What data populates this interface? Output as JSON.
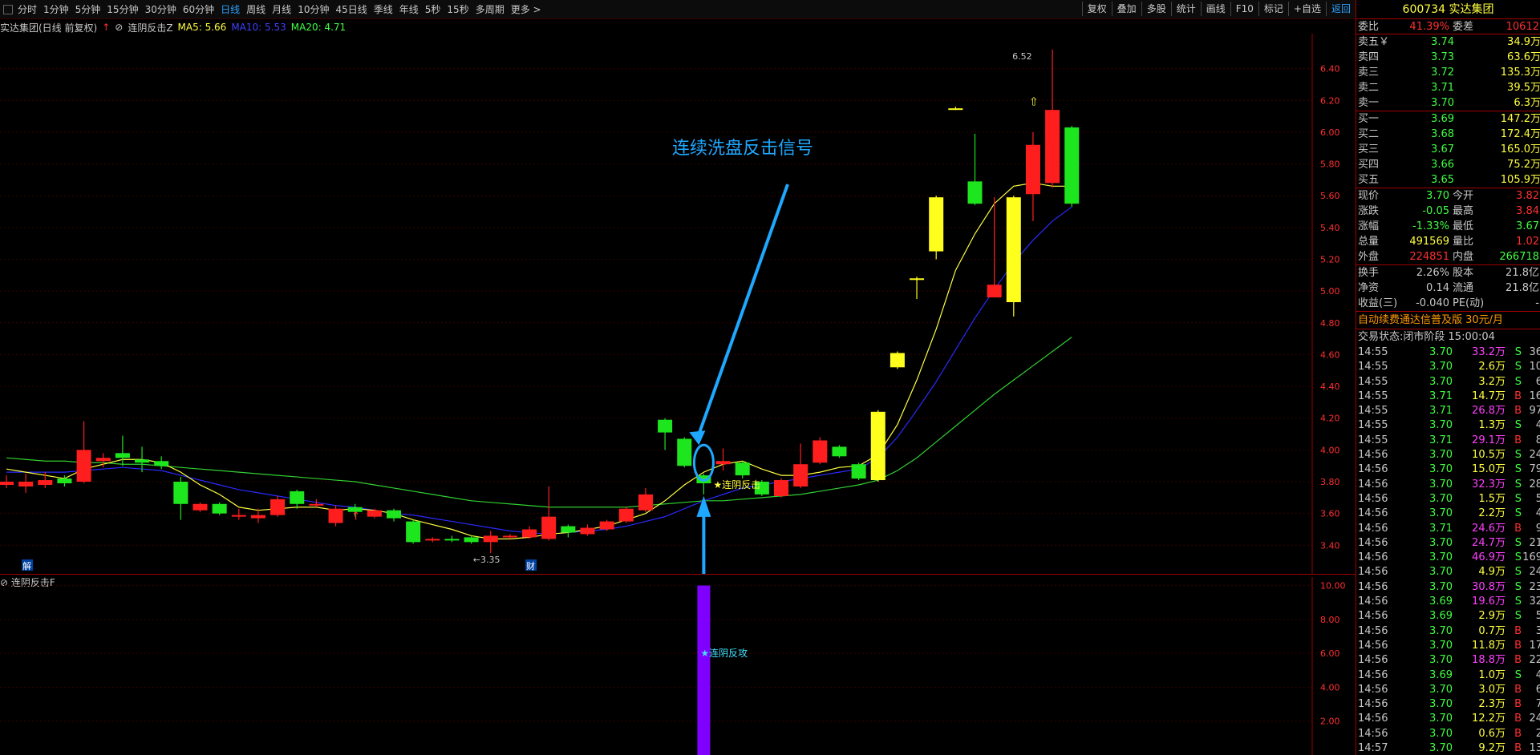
{
  "toolbar": {
    "timeframes": [
      "分时",
      "1分钟",
      "5分钟",
      "15分钟",
      "30分钟",
      "60分钟",
      "日线",
      "周线",
      "月线",
      "10分钟",
      "45日线",
      "季线",
      "年线",
      "5秒",
      "15秒",
      "多周期",
      "更多 >"
    ],
    "active_timeframe": "日线",
    "right_buttons": [
      "复权",
      "叠加",
      "多股",
      "统计",
      "画线",
      "F10",
      "标记",
      "+自选",
      "返回"
    ]
  },
  "chart_header": {
    "stock_name": "实达集团(日线 前复权)",
    "indicator_name": "连阴反击Z",
    "ma5": "MA5: 5.66",
    "ma10": "MA10: 5.53",
    "ma20": "MA20: 4.71"
  },
  "chart_data": {
    "type": "candlestick",
    "y_axis_ticks": [
      "6.40",
      "6.20",
      "6.00",
      "5.80",
      "5.60",
      "5.40",
      "5.20",
      "5.00",
      "4.80",
      "4.60",
      "4.40",
      "4.20",
      "4.00",
      "3.80",
      "3.60",
      "3.40"
    ],
    "ylim": [
      3.22,
      6.62
    ],
    "candles": [
      {
        "o": 3.78,
        "c": 3.8,
        "h": 3.84,
        "l": 3.76
      },
      {
        "o": 3.77,
        "c": 3.8,
        "h": 3.85,
        "l": 3.73
      },
      {
        "o": 3.78,
        "c": 3.81,
        "h": 3.86,
        "l": 3.76
      },
      {
        "o": 3.82,
        "c": 3.79,
        "h": 3.84,
        "l": 3.77
      },
      {
        "o": 3.8,
        "c": 4.0,
        "h": 4.18,
        "l": 3.79
      },
      {
        "o": 3.93,
        "c": 3.95,
        "h": 3.98,
        "l": 3.89
      },
      {
        "o": 3.98,
        "c": 3.95,
        "h": 4.09,
        "l": 3.9
      },
      {
        "o": 3.94,
        "c": 3.92,
        "h": 4.02,
        "l": 3.86
      },
      {
        "o": 3.93,
        "c": 3.9,
        "h": 3.96,
        "l": 3.88
      },
      {
        "o": 3.8,
        "c": 3.66,
        "h": 3.83,
        "l": 3.56
      },
      {
        "o": 3.62,
        "c": 3.66,
        "h": 3.67,
        "l": 3.61
      },
      {
        "o": 3.66,
        "c": 3.6,
        "h": 3.67,
        "l": 3.59
      },
      {
        "o": 3.58,
        "c": 3.59,
        "h": 3.63,
        "l": 3.56
      },
      {
        "o": 3.57,
        "c": 3.59,
        "h": 3.63,
        "l": 3.54
      },
      {
        "o": 3.59,
        "c": 3.69,
        "h": 3.71,
        "l": 3.58
      },
      {
        "o": 3.74,
        "c": 3.66,
        "h": 3.75,
        "l": 3.63
      },
      {
        "o": 3.65,
        "c": 3.66,
        "h": 3.69,
        "l": 3.64
      },
      {
        "o": 3.54,
        "c": 3.63,
        "h": 3.65,
        "l": 3.52
      },
      {
        "o": 3.64,
        "c": 3.61,
        "h": 3.66,
        "l": 3.58
      },
      {
        "o": 3.58,
        "c": 3.62,
        "h": 3.63,
        "l": 3.57
      },
      {
        "o": 3.62,
        "c": 3.57,
        "h": 3.63,
        "l": 3.55
      },
      {
        "o": 3.55,
        "c": 3.42,
        "h": 3.56,
        "l": 3.41
      },
      {
        "o": 3.43,
        "c": 3.44,
        "h": 3.45,
        "l": 3.42
      },
      {
        "o": 3.44,
        "c": 3.43,
        "h": 3.46,
        "l": 3.42
      },
      {
        "o": 3.45,
        "c": 3.42,
        "h": 3.46,
        "l": 3.41
      },
      {
        "o": 3.42,
        "c": 3.46,
        "h": 3.49,
        "l": 3.35
      },
      {
        "o": 3.46,
        "c": 3.46,
        "h": 3.47,
        "l": 3.44
      },
      {
        "o": 3.45,
        "c": 3.5,
        "h": 3.52,
        "l": 3.44
      },
      {
        "o": 3.44,
        "c": 3.58,
        "h": 3.77,
        "l": 3.43
      },
      {
        "o": 3.52,
        "c": 3.48,
        "h": 3.53,
        "l": 3.45
      },
      {
        "o": 3.47,
        "c": 3.51,
        "h": 3.53,
        "l": 3.46
      },
      {
        "o": 3.5,
        "c": 3.55,
        "h": 3.56,
        "l": 3.49
      },
      {
        "o": 3.55,
        "c": 3.63,
        "h": 3.64,
        "l": 3.54
      },
      {
        "o": 3.62,
        "c": 3.72,
        "h": 3.76,
        "l": 3.61
      },
      {
        "o": 4.19,
        "c": 4.11,
        "h": 4.2,
        "l": 4.0
      },
      {
        "o": 4.07,
        "c": 3.9,
        "h": 4.08,
        "l": 3.89
      },
      {
        "o": 3.84,
        "c": 3.79,
        "h": 3.85,
        "l": 3.72
      },
      {
        "o": 3.91,
        "c": 3.93,
        "h": 4.01,
        "l": 3.87
      },
      {
        "o": 3.92,
        "c": 3.84,
        "h": 3.93,
        "l": 3.82
      },
      {
        "o": 3.8,
        "c": 3.72,
        "h": 3.81,
        "l": 3.71
      },
      {
        "o": 3.71,
        "c": 3.81,
        "h": 3.82,
        "l": 3.7
      },
      {
        "o": 3.77,
        "c": 3.91,
        "h": 4.04,
        "l": 3.76
      },
      {
        "o": 3.92,
        "c": 4.06,
        "h": 4.08,
        "l": 3.91
      },
      {
        "o": 4.02,
        "c": 3.96,
        "h": 4.03,
        "l": 3.95
      },
      {
        "o": 3.91,
        "c": 3.82,
        "h": 3.92,
        "l": 3.81
      },
      {
        "o": 4.24,
        "c": 3.81,
        "h": 4.25,
        "l": 3.8
      },
      {
        "o": 4.61,
        "c": 4.52,
        "h": 4.62,
        "l": 4.51
      },
      {
        "o": 5.08,
        "c": 5.07,
        "h": 5.09,
        "l": 4.95
      },
      {
        "o": 5.59,
        "c": 5.25,
        "h": 5.6,
        "l": 5.2
      },
      {
        "o": 6.15,
        "c": 6.15,
        "h": 6.16,
        "l": 6.14
      },
      {
        "o": 5.69,
        "c": 5.55,
        "h": 5.99,
        "l": 5.54
      },
      {
        "o": 4.96,
        "c": 5.04,
        "h": 5.59,
        "l": 4.96
      },
      {
        "o": 5.59,
        "c": 4.93,
        "h": 5.6,
        "l": 4.84
      },
      {
        "o": 5.61,
        "c": 5.92,
        "h": 6.0,
        "l": 5.44
      },
      {
        "o": 5.68,
        "c": 6.14,
        "h": 6.52,
        "l": 5.65
      },
      {
        "o": 6.03,
        "c": 5.55,
        "h": 6.04,
        "l": 5.53
      }
    ],
    "ma5": [
      3.88,
      3.86,
      3.84,
      3.82,
      3.88,
      3.91,
      3.94,
      3.94,
      3.92,
      3.86,
      3.78,
      3.72,
      3.64,
      3.62,
      3.63,
      3.64,
      3.64,
      3.62,
      3.63,
      3.62,
      3.6,
      3.56,
      3.53,
      3.5,
      3.46,
      3.44,
      3.44,
      3.45,
      3.47,
      3.48,
      3.5,
      3.52,
      3.56,
      3.6,
      3.68,
      3.78,
      3.86,
      3.91,
      3.93,
      3.88,
      3.84,
      3.84,
      3.86,
      3.89,
      3.9,
      3.97,
      4.16,
      4.44,
      4.76,
      5.13,
      5.36,
      5.55,
      5.66,
      5.68,
      5.66,
      5.66
    ],
    "ma10": [
      3.86,
      3.86,
      3.86,
      3.86,
      3.87,
      3.88,
      3.89,
      3.88,
      3.87,
      3.84,
      3.81,
      3.78,
      3.75,
      3.73,
      3.71,
      3.69,
      3.67,
      3.65,
      3.64,
      3.62,
      3.6,
      3.59,
      3.57,
      3.55,
      3.53,
      3.51,
      3.49,
      3.48,
      3.47,
      3.48,
      3.49,
      3.5,
      3.52,
      3.55,
      3.58,
      3.63,
      3.68,
      3.72,
      3.76,
      3.78,
      3.8,
      3.82,
      3.84,
      3.86,
      3.88,
      3.95,
      4.08,
      4.25,
      4.43,
      4.63,
      4.83,
      5.01,
      5.18,
      5.32,
      5.44,
      5.53
    ],
    "ma20": [
      3.95,
      3.94,
      3.93,
      3.93,
      3.92,
      3.92,
      3.91,
      3.91,
      3.9,
      3.89,
      3.88,
      3.87,
      3.86,
      3.85,
      3.84,
      3.83,
      3.82,
      3.81,
      3.8,
      3.78,
      3.76,
      3.74,
      3.72,
      3.7,
      3.68,
      3.67,
      3.66,
      3.65,
      3.64,
      3.64,
      3.64,
      3.64,
      3.64,
      3.65,
      3.66,
      3.67,
      3.68,
      3.68,
      3.69,
      3.7,
      3.71,
      3.72,
      3.74,
      3.76,
      3.78,
      3.81,
      3.87,
      3.95,
      4.05,
      4.15,
      4.25,
      4.35,
      4.44,
      4.53,
      4.62,
      4.71
    ],
    "annotations": {
      "low_label": "←3.35",
      "high_label": "6.52",
      "signal_label": "★连阴反击",
      "callout_text": "连续洗盘反击信号",
      "bottom_marks": [
        "解",
        "财"
      ]
    }
  },
  "sub_chart": {
    "title": "连阴反击F",
    "y_ticks": [
      "10.00",
      "8.00",
      "6.00",
      "4.00",
      "2.00"
    ],
    "ylim": [
      0,
      10.5
    ],
    "signal_value": 10,
    "signal_label": "★连阴反攻"
  },
  "colors": {
    "up": "#ff1e1e",
    "down": "#1ee61e",
    "limit": "#ffff1e",
    "ma5": "#ffff40",
    "ma10": "#2a2aff",
    "ma20": "#30d030",
    "signal": "#8000ff",
    "callout": "#1fa8ff"
  },
  "panel": {
    "code_title": "600734 实达集团",
    "weibi": {
      "label": "委比",
      "value": "41.39%",
      "label2": "委差",
      "value2": "10612"
    },
    "asks": [
      {
        "label": "卖五￥",
        "price": "3.74",
        "vol": "34.9万"
      },
      {
        "label": "卖四",
        "price": "3.73",
        "vol": "63.6万"
      },
      {
        "label": "卖三",
        "price": "3.72",
        "vol": "135.3万"
      },
      {
        "label": "卖二",
        "price": "3.71",
        "vol": "39.5万"
      },
      {
        "label": "卖一",
        "price": "3.70",
        "vol": "6.3万"
      }
    ],
    "bids": [
      {
        "label": "买一",
        "price": "3.69",
        "vol": "147.2万"
      },
      {
        "label": "买二",
        "price": "3.68",
        "vol": "172.4万"
      },
      {
        "label": "买三",
        "price": "3.67",
        "vol": "165.0万"
      },
      {
        "label": "买四",
        "price": "3.66",
        "vol": "75.2万"
      },
      {
        "label": "买五",
        "price": "3.65",
        "vol": "105.9万"
      }
    ],
    "quote1": [
      {
        "l1": "现价",
        "v1": "3.70",
        "c1": "#40ff40",
        "l2": "今开",
        "v2": "3.82",
        "c2": "#ff3030"
      },
      {
        "l1": "涨跌",
        "v1": "-0.05",
        "c1": "#40ff40",
        "l2": "最高",
        "v2": "3.84",
        "c2": "#ff3030"
      },
      {
        "l1": "涨幅",
        "v1": "-1.33%",
        "c1": "#40ff40",
        "l2": "最低",
        "v2": "3.67",
        "c2": "#40ff40"
      },
      {
        "l1": "总量",
        "v1": "491569",
        "c1": "#ffff40",
        "l2": "量比",
        "v2": "1.02",
        "c2": "#ff3030"
      },
      {
        "l1": "外盘",
        "v1": "224851",
        "c1": "#ff3030",
        "l2": "内盘",
        "v2": "266718",
        "c2": "#40ff40"
      }
    ],
    "quote2": [
      {
        "l1": "换手",
        "v1": "2.26%",
        "c1": "#c8c8c8",
        "l2": "股本",
        "v2": "21.8亿",
        "c2": "#c8c8c8"
      },
      {
        "l1": "净资",
        "v1": "0.14",
        "c1": "#c8c8c8",
        "l2": "流通",
        "v2": "21.8亿",
        "c2": "#c8c8c8"
      },
      {
        "l1": "收益(三)",
        "v1": "-0.040",
        "c1": "#c8c8c8",
        "l2": "PE(动)",
        "v2": "-",
        "c2": "#c8c8c8"
      }
    ],
    "promo": "自动续费通达信普及版 30元/月",
    "status_label": "交易状态:",
    "status_value": "闭市阶段 15:00:04",
    "ticks": [
      {
        "t": "14:55",
        "p": "3.70",
        "v": "33.2万",
        "vc": "#ff40ff",
        "bs": "S",
        "n": "36"
      },
      {
        "t": "14:55",
        "p": "3.70",
        "v": "2.6万",
        "vc": "#ffff40",
        "bs": "S",
        "n": "10"
      },
      {
        "t": "14:55",
        "p": "3.70",
        "v": "3.2万",
        "vc": "#ffff40",
        "bs": "S",
        "n": "6"
      },
      {
        "t": "14:55",
        "p": "3.71",
        "v": "14.7万",
        "vc": "#ffff40",
        "bs": "B",
        "n": "16"
      },
      {
        "t": "14:55",
        "p": "3.71",
        "v": "26.8万",
        "vc": "#ff40ff",
        "bs": "B",
        "n": "97"
      },
      {
        "t": "14:55",
        "p": "3.70",
        "v": "1.3万",
        "vc": "#ffff40",
        "bs": "S",
        "n": "4"
      },
      {
        "t": "14:55",
        "p": "3.71",
        "v": "29.1万",
        "vc": "#ff40ff",
        "bs": "B",
        "n": "8"
      },
      {
        "t": "14:56",
        "p": "3.70",
        "v": "10.5万",
        "vc": "#ffff40",
        "bs": "S",
        "n": "24"
      },
      {
        "t": "14:56",
        "p": "3.70",
        "v": "15.0万",
        "vc": "#ffff40",
        "bs": "S",
        "n": "79"
      },
      {
        "t": "14:56",
        "p": "3.70",
        "v": "32.3万",
        "vc": "#ff40ff",
        "bs": "S",
        "n": "28"
      },
      {
        "t": "14:56",
        "p": "3.70",
        "v": "1.5万",
        "vc": "#ffff40",
        "bs": "S",
        "n": "5"
      },
      {
        "t": "14:56",
        "p": "3.70",
        "v": "2.2万",
        "vc": "#ffff40",
        "bs": "S",
        "n": "4"
      },
      {
        "t": "14:56",
        "p": "3.71",
        "v": "24.6万",
        "vc": "#ff40ff",
        "bs": "B",
        "n": "9"
      },
      {
        "t": "14:56",
        "p": "3.70",
        "v": "24.7万",
        "vc": "#ff40ff",
        "bs": "S",
        "n": "21"
      },
      {
        "t": "14:56",
        "p": "3.70",
        "v": "46.9万",
        "vc": "#ff40ff",
        "bs": "S",
        "n": "169"
      },
      {
        "t": "14:56",
        "p": "3.70",
        "v": "4.9万",
        "vc": "#ffff40",
        "bs": "S",
        "n": "24"
      },
      {
        "t": "14:56",
        "p": "3.70",
        "v": "30.8万",
        "vc": "#ff40ff",
        "bs": "S",
        "n": "23"
      },
      {
        "t": "14:56",
        "p": "3.69",
        "v": "19.6万",
        "vc": "#ff40ff",
        "bs": "S",
        "n": "32"
      },
      {
        "t": "14:56",
        "p": "3.69",
        "v": "2.9万",
        "vc": "#ffff40",
        "bs": "S",
        "n": "5"
      },
      {
        "t": "14:56",
        "p": "3.70",
        "v": "0.7万",
        "vc": "#ffff40",
        "bs": "B",
        "n": "3"
      },
      {
        "t": "14:56",
        "p": "3.70",
        "v": "11.8万",
        "vc": "#ffff40",
        "bs": "B",
        "n": "17"
      },
      {
        "t": "14:56",
        "p": "3.70",
        "v": "18.8万",
        "vc": "#ff40ff",
        "bs": "B",
        "n": "22"
      },
      {
        "t": "14:56",
        "p": "3.69",
        "v": "1.0万",
        "vc": "#ffff40",
        "bs": "S",
        "n": "4"
      },
      {
        "t": "14:56",
        "p": "3.70",
        "v": "3.0万",
        "vc": "#ffff40",
        "bs": "B",
        "n": "6"
      },
      {
        "t": "14:56",
        "p": "3.70",
        "v": "2.3万",
        "vc": "#ffff40",
        "bs": "B",
        "n": "7"
      },
      {
        "t": "14:56",
        "p": "3.70",
        "v": "12.2万",
        "vc": "#ffff40",
        "bs": "B",
        "n": "24"
      },
      {
        "t": "14:56",
        "p": "3.70",
        "v": "0.6万",
        "vc": "#ffff40",
        "bs": "B",
        "n": "2"
      },
      {
        "t": "14:57",
        "p": "3.70",
        "v": "9.2万",
        "vc": "#ffff40",
        "bs": "B",
        "n": "13"
      }
    ]
  }
}
